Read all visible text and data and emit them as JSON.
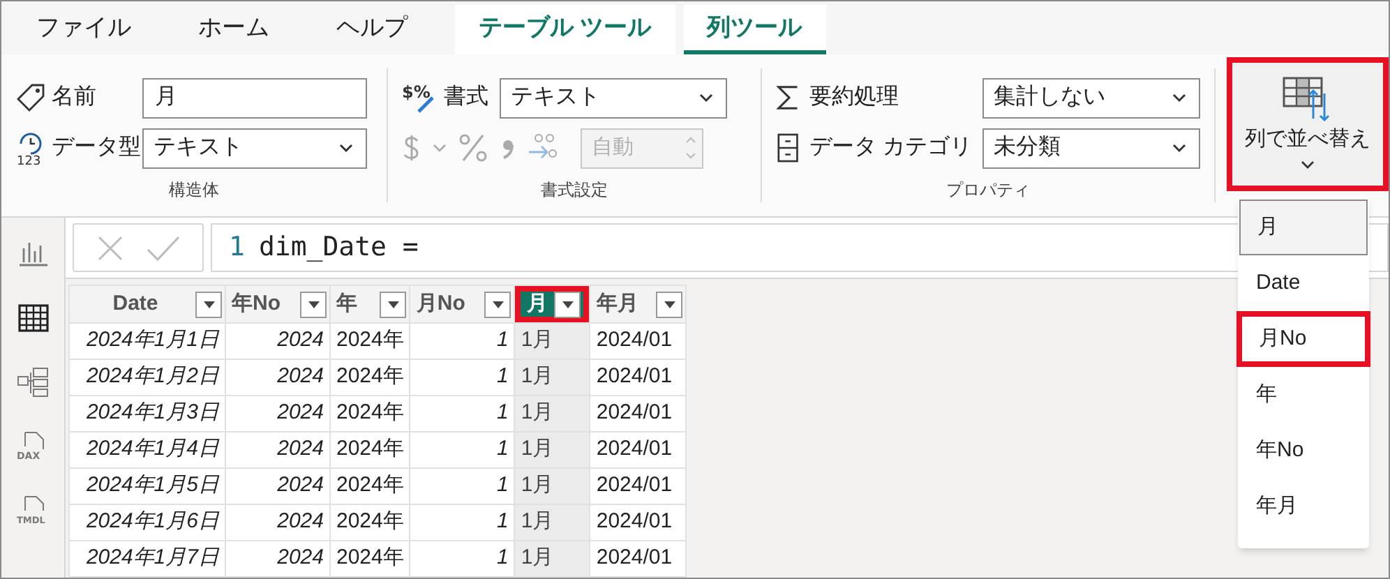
{
  "tabs": [
    {
      "label": "ファイル",
      "selected": false,
      "kind": "plain"
    },
    {
      "label": "ホーム",
      "selected": false,
      "kind": "plain"
    },
    {
      "label": "ヘルプ",
      "selected": false,
      "kind": "plain"
    },
    {
      "label": "テーブル ツール",
      "selected": false,
      "kind": "context"
    },
    {
      "label": "列ツール",
      "selected": true,
      "kind": "context"
    }
  ],
  "ribbon": {
    "structure": {
      "name_label": "名前",
      "name_value": "月",
      "type_icon_text": "123",
      "type_label": "データ型",
      "type_value": "テキスト",
      "group_label": "構造体"
    },
    "formatting": {
      "format_icon_text": "$%",
      "format_label": "書式",
      "format_value": "テキスト",
      "decimals_value": "自動",
      "group_label": "書式設定"
    },
    "properties": {
      "summary_label": "要約処理",
      "summary_value": "集計しない",
      "category_label": "データ カテゴリ",
      "category_value": "未分類",
      "group_label": "プロパティ"
    },
    "sort_button": {
      "label": "列で並べ替え",
      "highlighted": true
    }
  },
  "sort_menu": [
    {
      "label": "月",
      "selected": true,
      "highlighted": false
    },
    {
      "label": "Date",
      "selected": false,
      "highlighted": false
    },
    {
      "label": "月No",
      "selected": false,
      "highlighted": true
    },
    {
      "label": "年",
      "selected": false,
      "highlighted": false
    },
    {
      "label": "年No",
      "selected": false,
      "highlighted": false
    },
    {
      "label": "年月",
      "selected": false,
      "highlighted": false
    }
  ],
  "side_rail": [
    {
      "kind": "report",
      "selected": false
    },
    {
      "kind": "table",
      "selected": true
    },
    {
      "kind": "model",
      "selected": false
    },
    {
      "kind": "dax",
      "selected": false,
      "icon_text": "DAX"
    },
    {
      "kind": "tmdl",
      "selected": false,
      "icon_text": "TMDL"
    }
  ],
  "formula_bar": {
    "line_number": "1",
    "formula": "dim_Date ="
  },
  "table": {
    "columns": [
      {
        "label": "Date",
        "kind": "date",
        "selected": false,
        "highlighted": false
      },
      {
        "label": "年No",
        "kind": "number",
        "selected": false,
        "highlighted": false
      },
      {
        "label": "年",
        "kind": "text",
        "selected": false,
        "highlighted": false
      },
      {
        "label": "月No",
        "kind": "number",
        "selected": false,
        "highlighted": false
      },
      {
        "label": "月",
        "kind": "text",
        "selected": true,
        "highlighted": true
      },
      {
        "label": "年月",
        "kind": "text",
        "selected": false,
        "highlighted": false
      }
    ],
    "rows": [
      [
        "2024年1月1日",
        "2024",
        "2024年",
        "1",
        "1月",
        "2024/01"
      ],
      [
        "2024年1月2日",
        "2024",
        "2024年",
        "1",
        "1月",
        "2024/01"
      ],
      [
        "2024年1月3日",
        "2024",
        "2024年",
        "1",
        "1月",
        "2024/01"
      ],
      [
        "2024年1月4日",
        "2024",
        "2024年",
        "1",
        "1月",
        "2024/01"
      ],
      [
        "2024年1月5日",
        "2024",
        "2024年",
        "1",
        "1月",
        "2024/01"
      ],
      [
        "2024年1月6日",
        "2024",
        "2024年",
        "1",
        "1月",
        "2024/01"
      ],
      [
        "2024年1月7日",
        "2024",
        "2024年",
        "1",
        "1月",
        "2024/01"
      ]
    ]
  }
}
